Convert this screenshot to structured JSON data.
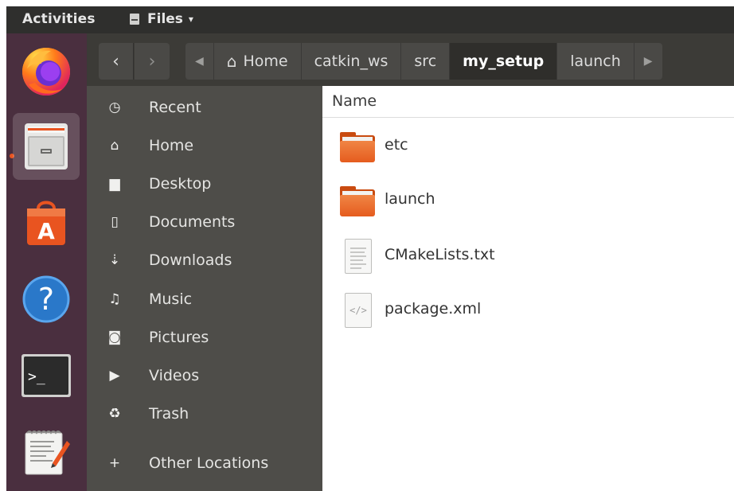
{
  "topbar": {
    "activities_label": "Activities",
    "app_name": "Files",
    "app_menu_caret": "▾"
  },
  "dock": {
    "items": [
      {
        "name": "Firefox",
        "icon": "firefox-icon"
      },
      {
        "name": "Files",
        "icon": "file-manager-icon",
        "active": true
      },
      {
        "name": "Ubuntu Software",
        "icon": "software-store-icon"
      },
      {
        "name": "Help",
        "icon": "help-icon"
      },
      {
        "name": "Terminal",
        "icon": "terminal-icon"
      },
      {
        "name": "Text Editor",
        "icon": "text-editor-icon"
      }
    ],
    "colors": {
      "background": "#4a2f3f",
      "active_dot": "#e95420"
    }
  },
  "header": {
    "back_glyph": "‹",
    "forward_glyph": "›",
    "left_arrow": "◀",
    "right_arrow": "▶",
    "home_glyph": "⌂",
    "breadcrumbs": [
      "Home",
      "catkin_ws",
      "src",
      "my_setup",
      "launch"
    ],
    "current_crumb": "my_setup"
  },
  "sidebar": {
    "items": [
      {
        "label": "Recent",
        "icon": "clock-icon",
        "glyph": "◷"
      },
      {
        "label": "Home",
        "icon": "home-icon",
        "glyph": "⌂"
      },
      {
        "label": "Desktop",
        "icon": "folder-icon",
        "glyph": "▆"
      },
      {
        "label": "Documents",
        "icon": "document-icon",
        "glyph": "▯"
      },
      {
        "label": "Downloads",
        "icon": "download-icon",
        "glyph": "⇣"
      },
      {
        "label": "Music",
        "icon": "music-icon",
        "glyph": "♫"
      },
      {
        "label": "Pictures",
        "icon": "camera-icon",
        "glyph": "◙"
      },
      {
        "label": "Videos",
        "icon": "video-icon",
        "glyph": "▶"
      },
      {
        "label": "Trash",
        "icon": "trash-icon",
        "glyph": "♻"
      },
      {
        "label": "Other Locations",
        "icon": "plus-icon",
        "glyph": "+"
      }
    ]
  },
  "content": {
    "column_header": "Name",
    "files": [
      {
        "name": "etc",
        "type": "folder",
        "icon": "folder-icon"
      },
      {
        "name": "launch",
        "type": "folder",
        "icon": "folder-icon"
      },
      {
        "name": "CMakeLists.txt",
        "type": "text",
        "icon": "text-file-icon"
      },
      {
        "name": "package.xml",
        "type": "xml",
        "icon": "xml-file-icon"
      }
    ],
    "colors": {
      "folder": "#e55c1e"
    }
  }
}
